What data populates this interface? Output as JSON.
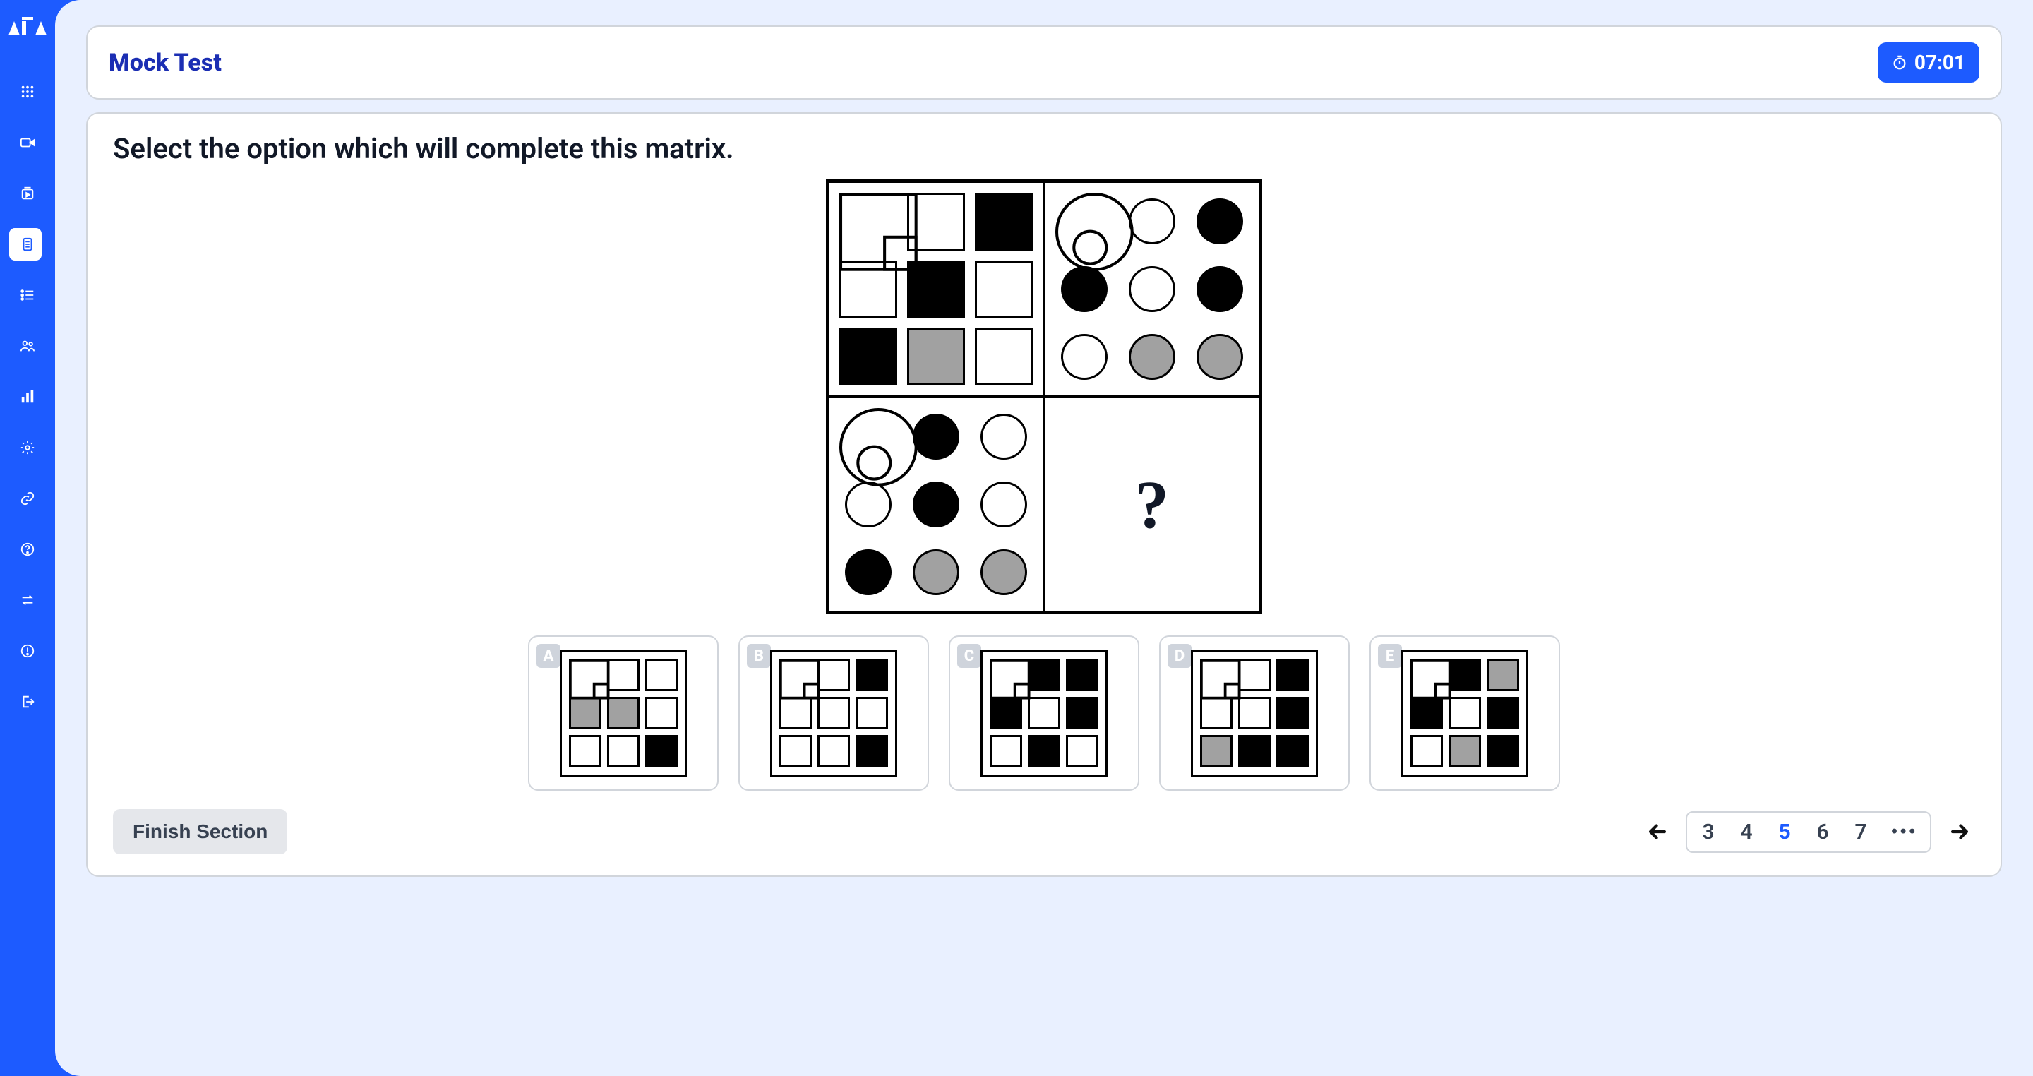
{
  "header": {
    "title": "Mock Test",
    "timer": "07:01"
  },
  "question": {
    "prompt": "Select the option which will complete this matrix.",
    "missing_marker": "?"
  },
  "sidebar": {
    "icons": [
      "grid",
      "video",
      "play-library",
      "document",
      "list",
      "users",
      "bar-chart",
      "gear",
      "link",
      "help",
      "swap",
      "alert",
      "logout"
    ],
    "active_index": 3
  },
  "matrix": {
    "top_left": {
      "shapes": "squares",
      "big_outer": "black",
      "big_inner": "white",
      "row1": [
        "white",
        "black"
      ],
      "row2": [
        "white",
        "black",
        "white"
      ],
      "row3": [
        "black",
        "grey",
        "white"
      ]
    },
    "top_right": {
      "shapes": "circles",
      "big_outer": "grey",
      "big_inner": "white",
      "row1": [
        "white",
        "black"
      ],
      "row2": [
        "black",
        "white",
        "black"
      ],
      "row3": [
        "white",
        "grey",
        "grey"
      ]
    },
    "bottom_left": {
      "shapes": "circles",
      "big_outer": "grey",
      "big_inner": "black",
      "row1": [
        "black",
        "white"
      ],
      "row2": [
        "white",
        "black",
        "white"
      ],
      "row3": [
        "black",
        "grey",
        "grey"
      ]
    },
    "bottom_right": "missing"
  },
  "options": [
    {
      "label": "A",
      "big_outer": "white",
      "big_inner": "black",
      "row1": [
        "white",
        "white"
      ],
      "row2": [
        "grey",
        "grey",
        "white"
      ],
      "row3": [
        "white",
        "white",
        "black"
      ]
    },
    {
      "label": "B",
      "big_outer": "black",
      "big_inner": "white",
      "row1": [
        "white",
        "black"
      ],
      "row2": [
        "white",
        "white",
        "white"
      ],
      "row3": [
        "white",
        "white",
        "black"
      ]
    },
    {
      "label": "C",
      "big_outer": "white",
      "big_inner": "black",
      "row1": [
        "black",
        "black"
      ],
      "row2": [
        "black",
        "white",
        "black"
      ],
      "row3": [
        "white",
        "black",
        "white"
      ]
    },
    {
      "label": "D",
      "big_outer": "black",
      "big_inner": "grey",
      "row1": [
        "white",
        "black"
      ],
      "row2": [
        "white",
        "white",
        "black"
      ],
      "row3": [
        "grey",
        "black",
        "black"
      ]
    },
    {
      "label": "E",
      "big_outer": "white",
      "big_inner": "grey",
      "row1": [
        "black",
        "grey"
      ],
      "row2": [
        "black",
        "white",
        "black"
      ],
      "row3": [
        "white",
        "grey",
        "black"
      ]
    }
  ],
  "footer": {
    "finish_label": "Finish Section",
    "pages": [
      "3",
      "4",
      "5",
      "6",
      "7"
    ],
    "current_page": "5",
    "ellipsis": "•••"
  },
  "colors": {
    "brand": "#1D5BFF"
  }
}
